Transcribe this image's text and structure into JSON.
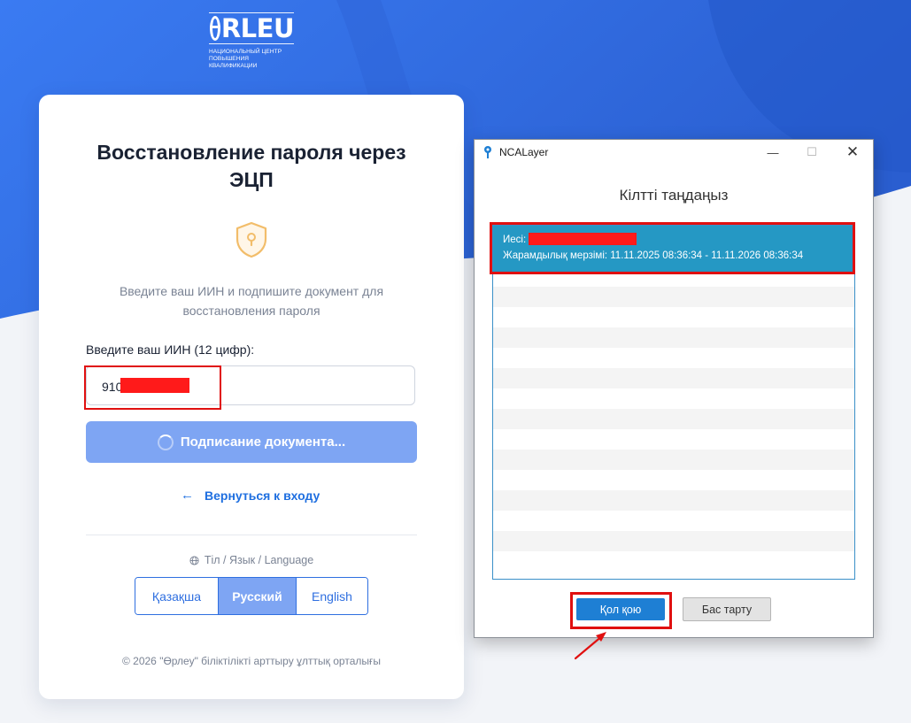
{
  "logo": {
    "brand": "ӨRLEU",
    "brand_rest": "RLEU",
    "subtitle_line1": "НАЦИОНАЛЬНЫЙ ЦЕНТР",
    "subtitle_line2": "ПОВЫШЕНИЯ КВАЛИФИКАЦИИ"
  },
  "card": {
    "title": "Восстановление пароля через ЭЦП",
    "description": "Введите ваш ИИН и подпишите документ для восстановления пароля",
    "iin_label": "Введите ваш ИИН (12 цифр):",
    "iin_value": "910",
    "sign_button": "Подписание документа...",
    "back_link": "Вернуться к входу",
    "language_label": "Тіл / Язык / Language",
    "languages": [
      {
        "label": "Қазақша",
        "active": false
      },
      {
        "label": "Русский",
        "active": true
      },
      {
        "label": "English",
        "active": false
      }
    ],
    "copyright": "© 2026 \"Өрлеу\" біліктілікті арттыру ұлттық орталығы"
  },
  "ncalayer": {
    "window_title": "NCALayer",
    "heading": "Кілтті таңдаңыз",
    "certificate": {
      "owner_label": "Иесі:",
      "validity": "Жарамдылық мерзімі: 11.11.2025 08:36:34 - 11.11.2026 08:36:34"
    },
    "sign_button": "Қол қою",
    "cancel_button": "Бас тарту"
  },
  "colors": {
    "brand_blue": "#2f6fe0",
    "button_disabled": "#7ea5f3",
    "cert_selected": "#2598c4",
    "annotation_red": "#e01010"
  }
}
